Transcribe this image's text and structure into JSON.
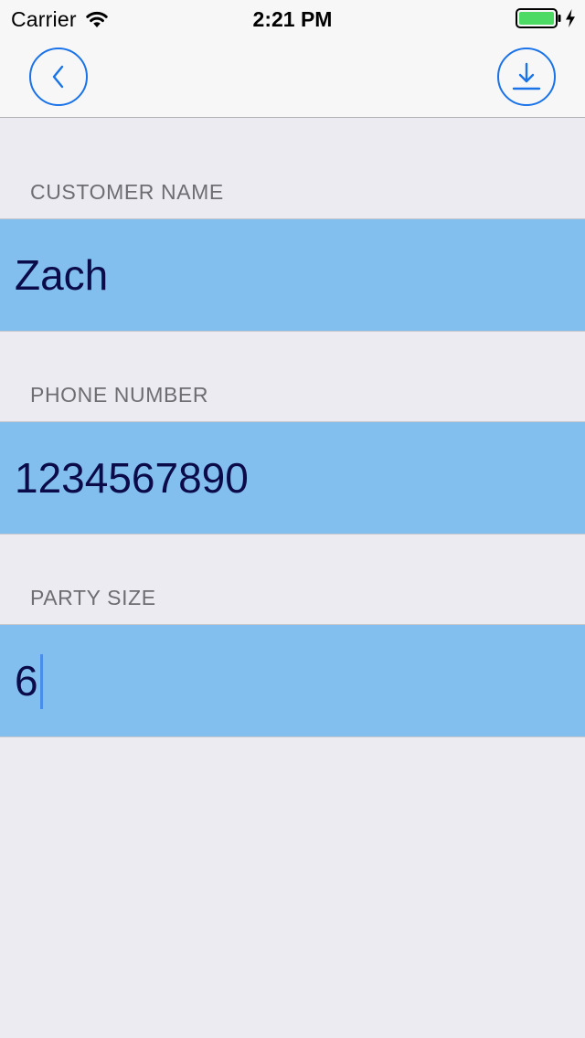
{
  "status_bar": {
    "carrier": "Carrier",
    "time": "2:21 PM"
  },
  "nav": {
    "back_icon": "chevron-left-icon",
    "download_icon": "download-icon",
    "accent_color": "#1A73E8"
  },
  "form": {
    "customer_name": {
      "label": "CUSTOMER NAME",
      "value": "Zach"
    },
    "phone_number": {
      "label": "PHONE NUMBER",
      "value": "1234567890"
    },
    "party_size": {
      "label": "PARTY SIZE",
      "value": "6"
    }
  },
  "colors": {
    "field_background": "#82BFEE",
    "page_background": "#ECEBF1",
    "value_text": "#0B0B4A",
    "label_text": "#6D6D72",
    "battery": "#4CD964"
  }
}
